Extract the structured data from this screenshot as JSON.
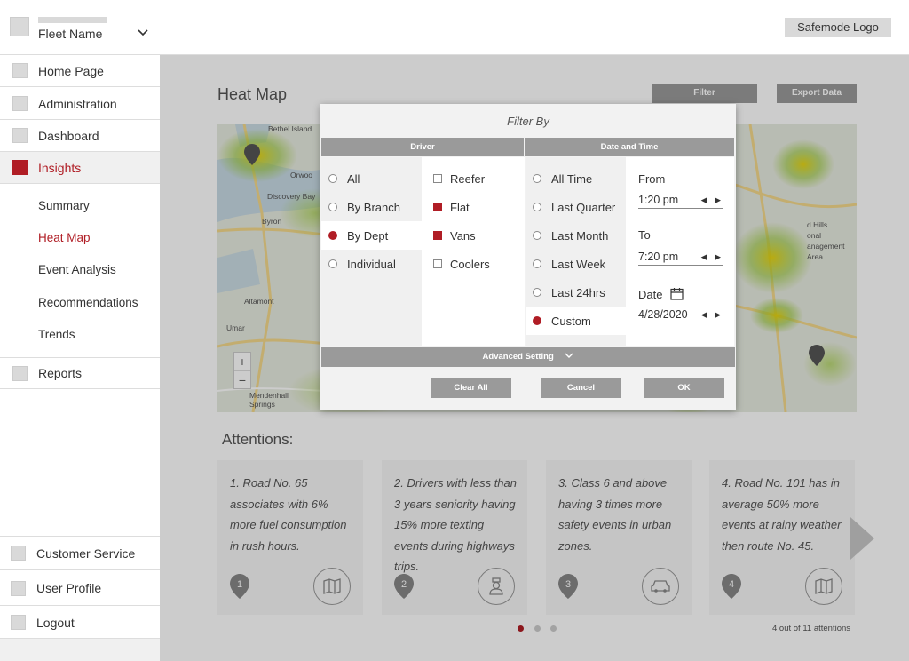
{
  "topbar": {
    "fleet_name": "Fleet Name",
    "logo": "Safemode Logo"
  },
  "sidebar": {
    "items": [
      {
        "label": "Home Page"
      },
      {
        "label": "Administration"
      },
      {
        "label": "Dashboard"
      },
      {
        "label": "Insights",
        "active": true
      },
      {
        "label": "Reports"
      }
    ],
    "sub_items": [
      {
        "label": "Summary"
      },
      {
        "label": "Heat Map",
        "active": true
      },
      {
        "label": "Event Analysis"
      },
      {
        "label": "Recommendations"
      },
      {
        "label": "Trends"
      }
    ],
    "footer_items": [
      {
        "label": "Customer Service"
      },
      {
        "label": "User Profile"
      },
      {
        "label": "Logout"
      }
    ]
  },
  "main": {
    "title": "Heat Map",
    "filter_button": "Filter",
    "export_button": "Export Data",
    "map_labels": {
      "l1": "Bethel Island",
      "l2": "Orwoo",
      "l3": "Discovery Bay",
      "l4": "Byron",
      "l5": "Altamont",
      "l6": "Umar",
      "l7": "Mendenhall Springs",
      "l8": "d Hills",
      "l9": "onal",
      "l10": "anagement",
      "l11": "Area"
    },
    "attentions_title": "Attentions:",
    "cards": [
      {
        "num": "1",
        "text": "1. Road No. 65 associates with 6% more fuel consumption in rush hours.",
        "icon": "map-icon"
      },
      {
        "num": "2",
        "text": "2. Drivers with less than 3 years seniority having 15% more texting events during highways trips.",
        "icon": "driver-icon"
      },
      {
        "num": "3",
        "text": "3. Class 6 and above having 3 times more safety events in urban zones.",
        "icon": "car-icon"
      },
      {
        "num": "4",
        "text": "4. Road No. 101 has in average 50% more events at rainy weather then route No. 45.",
        "icon": "map-icon"
      }
    ],
    "pager": "4 out of 11 attentions",
    "pager_active": 1
  },
  "dialog": {
    "title": "Filter By",
    "driver_header": "Driver",
    "datetime_header": "Date and Time",
    "driver_options": [
      {
        "label": "All",
        "selected": false
      },
      {
        "label": "By Branch",
        "selected": false
      },
      {
        "label": "By Dept",
        "selected": true
      },
      {
        "label": "Individual",
        "selected": false
      }
    ],
    "dept_options": [
      {
        "label": "Reefer",
        "checked": false
      },
      {
        "label": "Flat",
        "checked": true
      },
      {
        "label": "Vans",
        "checked": true
      },
      {
        "label": "Coolers",
        "checked": false
      }
    ],
    "time_options": [
      {
        "label": "All Time",
        "selected": false
      },
      {
        "label": "Last Quarter",
        "selected": false
      },
      {
        "label": "Last Month",
        "selected": false
      },
      {
        "label": "Last Week",
        "selected": false
      },
      {
        "label": "Last 24hrs",
        "selected": false
      },
      {
        "label": "Custom",
        "selected": true
      }
    ],
    "from_label": "From",
    "from_value": "1:20 pm",
    "to_label": "To",
    "to_value": "7:20 pm",
    "date_label": "Date",
    "date_value": "4/28/2020",
    "advanced_label": "Advanced Setting",
    "clear_button": "Clear All",
    "cancel_button": "Cancel",
    "ok_button": "OK"
  },
  "colors": {
    "accent": "#b01d25",
    "button_gray": "#9a9a9a"
  }
}
